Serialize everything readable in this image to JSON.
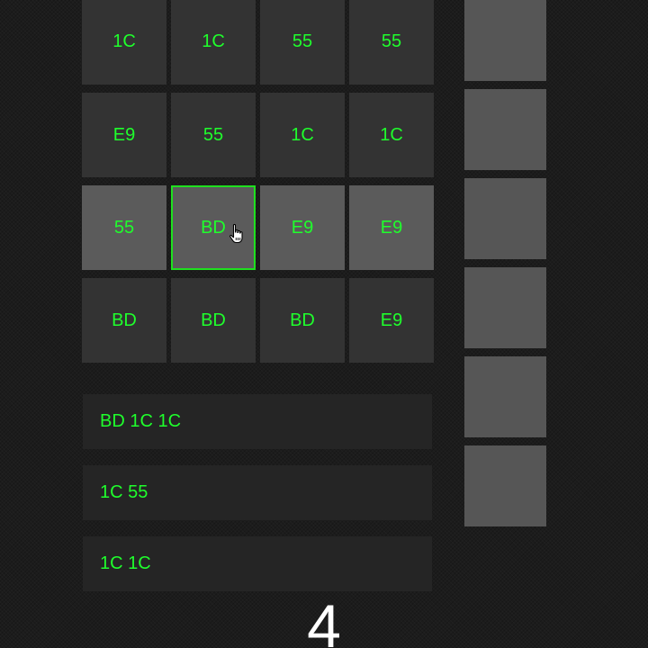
{
  "matrix": {
    "rows": [
      [
        "1C",
        "1C",
        "55",
        "55"
      ],
      [
        "E9",
        "55",
        "1C",
        "1C"
      ],
      [
        "55",
        "BD",
        "E9",
        "E9"
      ],
      [
        "BD",
        "BD",
        "BD",
        "E9"
      ]
    ],
    "active_row": 2,
    "selected_cell": {
      "row": 2,
      "col": 1
    }
  },
  "sequences": [
    "BD 1C 1C",
    "1C 55",
    "1C 1C"
  ],
  "buffer": {
    "slots": 6,
    "filled": []
  },
  "counter": "4",
  "colors": {
    "code_text": "#1fff2c",
    "cell_bg": "#333333",
    "active_row_bg": "#5b5b5b",
    "selection_border": "#1fe01f",
    "buffer_slot": "#565656"
  }
}
